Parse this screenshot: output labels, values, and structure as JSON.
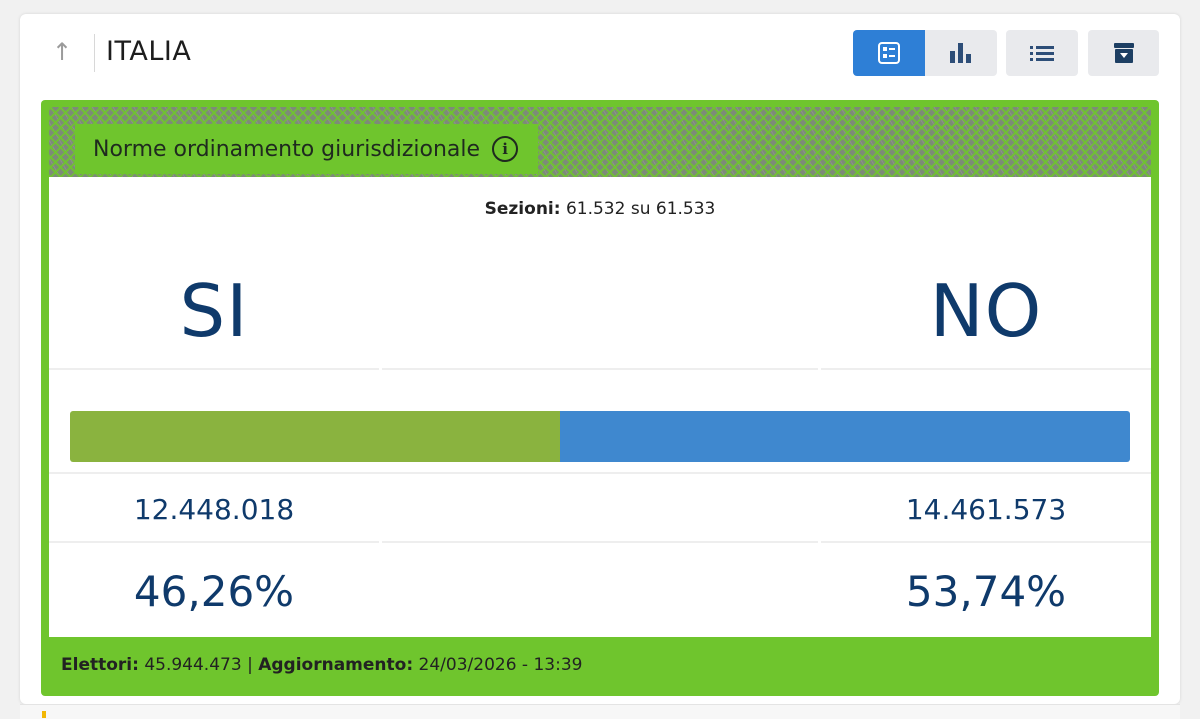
{
  "header": {
    "title": "ITALIA",
    "up_icon": "arrow-up-icon",
    "toolbar": [
      {
        "icon": "summary-view-icon",
        "active": true
      },
      {
        "icon": "bar-chart-icon",
        "active": false
      },
      {
        "icon": "list-icon",
        "active": false
      },
      {
        "icon": "archive-download-icon",
        "active": false
      }
    ]
  },
  "referendum": {
    "question": "Norme ordinamento giurisdizionale",
    "info_icon": "info-icon",
    "sezioni_label": "Sezioni:",
    "sezioni_value": "61.532 su 61.533",
    "si": {
      "label": "SI",
      "votes": "12.448.018",
      "percent": "46,26%",
      "share": 46.26,
      "color": "#8ab33f"
    },
    "no": {
      "label": "NO",
      "votes": "14.461.573",
      "percent": "53,74%",
      "share": 53.74,
      "color": "#3f88cf"
    },
    "elettori_label": "Elettori:",
    "elettori_value": "45.944.473",
    "aggiornamento_label": "Aggiornamento:",
    "aggiornamento_value": "24/03/2026 - 13:39"
  },
  "colors": {
    "accent": "#2e7fd6",
    "box_green": "#6fc52d",
    "text_blue": "#0f3a6b"
  }
}
